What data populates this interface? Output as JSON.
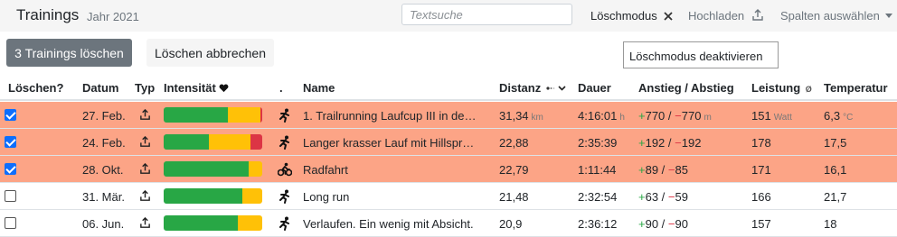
{
  "header": {
    "title": "Trainings",
    "subtitle": "Jahr 2021",
    "search_placeholder": "Textsuche",
    "delete_mode_label": "Löschmodus",
    "upload_label": "Hochladen",
    "columns_label": "Spalten auswählen"
  },
  "actions": {
    "delete_label": "3 Trainings löschen",
    "cancel_label": "Löschen abbrechen",
    "tooltip": "Löschmodus deaktivieren"
  },
  "columns": {
    "delete": "Löschen?",
    "date": "Datum",
    "type": "Typ",
    "intensity": "Intensität",
    "sport": ".",
    "name": "Name",
    "distance": "Distanz",
    "duration": "Dauer",
    "ascent": "Anstieg / Abstieg",
    "power": "Leistung",
    "power_suffix": "Ø",
    "temperature": "Temperatur"
  },
  "colors": {
    "selected_row": "#fca486",
    "intensity_low": "#28a745",
    "intensity_mid": "#ffc107",
    "intensity_high": "#dc3545"
  },
  "rows": [
    {
      "selected": true,
      "date": "27. Feb.",
      "type_icon": "upload-icon",
      "intensity": [
        0.65,
        0.33,
        0.02
      ],
      "sport_icon": "running-icon",
      "name": "1. Trailrunning Laufcup III in de…",
      "distance": "31,34",
      "distance_unit": "km",
      "duration": "4:16:01",
      "duration_unit": "h",
      "ascent": "770",
      "descent": "770",
      "ascent_unit": "m",
      "power": "151",
      "power_unit": "Watt",
      "temperature": "6,3",
      "temperature_unit": "°C"
    },
    {
      "selected": true,
      "date": "24. Feb.",
      "type_icon": "upload-icon",
      "intensity": [
        0.46,
        0.42,
        0.12
      ],
      "sport_icon": "running-icon",
      "name": "Langer krasser Lauf mit Hillspr…",
      "distance": "22,88",
      "duration": "2:35:39",
      "ascent": "192",
      "descent": "192",
      "power": "178",
      "temperature": "17,5"
    },
    {
      "selected": true,
      "date": "28. Okt.",
      "type_icon": "upload-icon",
      "intensity": [
        0.86,
        0.14,
        0.0
      ],
      "sport_icon": "cycling-icon",
      "name": "Radfahrt",
      "distance": "22,79",
      "duration": "1:11:44",
      "ascent": "89",
      "descent": "85",
      "power": "171",
      "temperature": "16,1"
    },
    {
      "selected": false,
      "date": "31. Mär.",
      "type_icon": "upload-icon",
      "intensity": [
        0.8,
        0.2,
        0.0
      ],
      "sport_icon": "running-icon",
      "name": "Long run",
      "distance": "21,48",
      "duration": "2:32:54",
      "ascent": "63",
      "descent": "59",
      "power": "166",
      "temperature": "21,7"
    },
    {
      "selected": false,
      "date": "06. Jun.",
      "type_icon": "upload-icon",
      "intensity": [
        0.75,
        0.25,
        0.0
      ],
      "sport_icon": "running-icon",
      "name": "Verlaufen. Ein wenig mit Absicht.",
      "distance": "20,9",
      "duration": "2:36:12",
      "ascent": "90",
      "descent": "90",
      "power": "157",
      "temperature": "18"
    }
  ]
}
